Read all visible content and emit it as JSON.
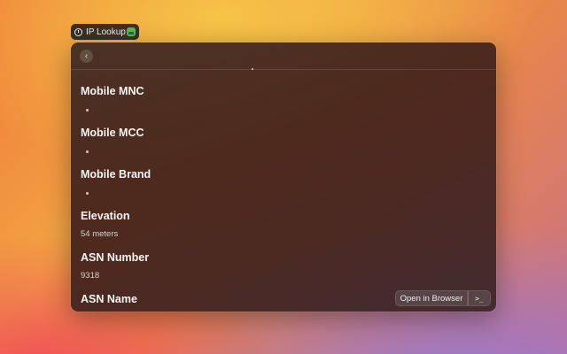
{
  "extension_tag": {
    "title": "IP Lookup",
    "icon_left": "clock-icon",
    "icon_right": "app-icon"
  },
  "header": {
    "back_icon": "chevron-left-icon",
    "back_glyph": "‹"
  },
  "details": [
    {
      "label": "Mobile MNC",
      "value": ""
    },
    {
      "label": "Mobile MCC",
      "value": ""
    },
    {
      "label": "Mobile Brand",
      "value": ""
    },
    {
      "label": "Elevation",
      "value": "54 meters"
    },
    {
      "label": "ASN Number",
      "value": "9318"
    },
    {
      "label": "ASN Name",
      "value": ""
    }
  ],
  "actions": {
    "open_label": "Open in Browser",
    "terminal_glyph": ">_"
  },
  "colors": {
    "window_bg": "#3e2822",
    "tag_bg": "#2d2623",
    "app_icon": "#5bb75b"
  }
}
